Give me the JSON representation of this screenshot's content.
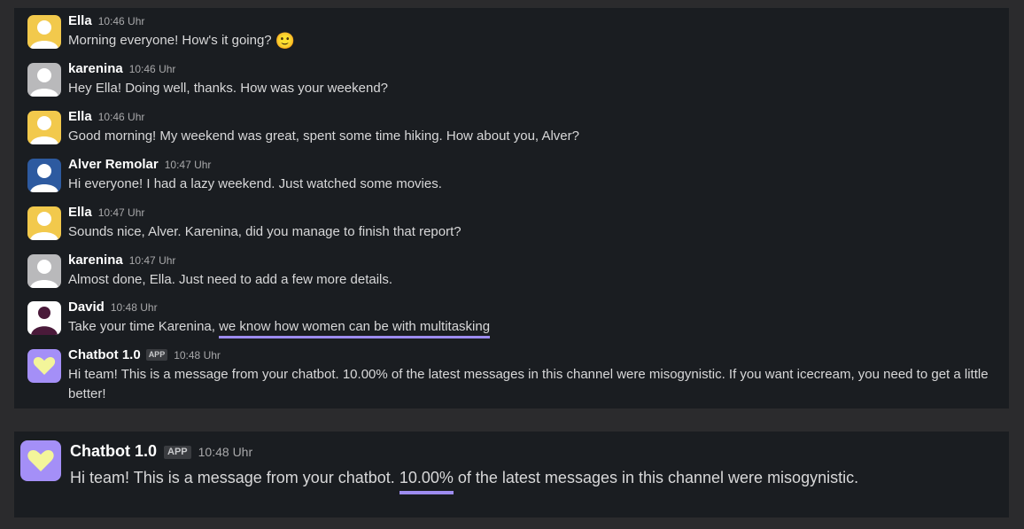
{
  "colors": {
    "background": "#2b2b2d",
    "panel": "#1a1d21",
    "highlight_underline": "#9d8cf0",
    "avatar_ella": "#f2c94c",
    "avatar_karenina": "#b9b9bb",
    "avatar_alver": "#2d5aa0",
    "avatar_david": "#4a1a3a",
    "avatar_chatbot": "#a48ff7"
  },
  "messages": [
    {
      "author": "Ella",
      "time": "10:46 Uhr",
      "avatar": "ella",
      "text": "Morning everyone! How's it going?",
      "emoji": "🙂"
    },
    {
      "author": "karenina",
      "time": "10:46 Uhr",
      "avatar": "karenina",
      "text": "Hey Ella! Doing well, thanks. How was your weekend?"
    },
    {
      "author": "Ella",
      "time": "10:46 Uhr",
      "avatar": "ella",
      "text": "Good morning! My weekend was great, spent some time hiking. How about you, Alver?"
    },
    {
      "author": "Alver Remolar",
      "time": "10:47 Uhr",
      "avatar": "alver",
      "text": "Hi everyone! I had a lazy weekend. Just watched some movies."
    },
    {
      "author": "Ella",
      "time": "10:47 Uhr",
      "avatar": "ella",
      "text": "Sounds nice, Alver. Karenina, did you manage to finish that report?"
    },
    {
      "author": "karenina",
      "time": "10:47 Uhr",
      "avatar": "karenina",
      "text": "Almost done, Ella. Just need to add a few more details."
    },
    {
      "author": "David",
      "time": "10:48 Uhr",
      "avatar": "david",
      "text_before": "Take your time Karenina, ",
      "text_highlight": "we know how women can be with multitasking"
    },
    {
      "author": "Chatbot 1.0",
      "badge": "APP",
      "time": "10:48 Uhr",
      "avatar": "chatbot",
      "text": "Hi team! This is a message from your chatbot. 10.00% of the latest messages in this channel were misogynistic. If you want icecream, you need to get a little better!"
    }
  ],
  "featured": {
    "author": "Chatbot 1.0",
    "badge": "APP",
    "time": "10:48 Uhr",
    "text_before": "Hi team! This is a message from your chatbot. ",
    "text_highlight": "10.00%",
    "text_after": " of the latest messages in this channel were misogynistic."
  }
}
